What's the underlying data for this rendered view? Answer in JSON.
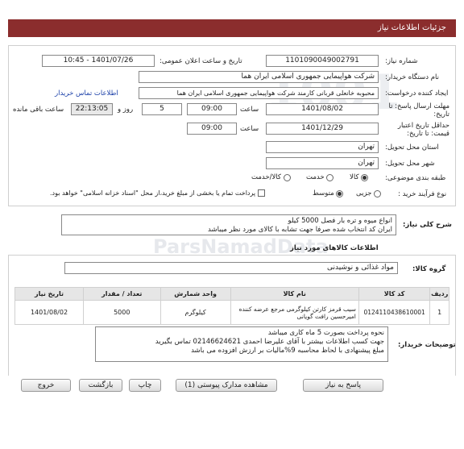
{
  "page_title": "جزئیات اطلاعات نیاز",
  "fields": {
    "need_number_label": "شماره نیاز:",
    "need_number": "1101090049002791",
    "announce_label": "تاریخ و ساعت اعلان عمومی:",
    "announce_value": "1401/07/26 - 10:45",
    "buyer_label": "نام دستگاه خریدار:",
    "buyer_value": "شرکت هواپیمایی جمهوری اسلامی ایران هما",
    "creator_label": "ایجاد کننده درخواست:",
    "creator_value": "محبوبه خانعلی قربانی کارمند شرکت هواپیمایی جمهوری اسلامی ایران هما",
    "contact_link": "اطلاعات تماس خریدار",
    "deadline_label": "مهلت ارسال پاسخ: تا تاریخ:",
    "deadline_date": "1401/08/02",
    "time_label": "ساعت",
    "deadline_time": "09:00",
    "days_value": "5",
    "days_label": "روز و",
    "remaining_time": "22:13:05",
    "remaining_label": "ساعت باقی مانده",
    "validity_label": "حداقل تاریخ اعتبار قیمت: تا تاریخ:",
    "validity_date": "1401/12/29",
    "validity_time": "09:00",
    "province_label": "استان محل تحویل:",
    "province_value": "تهران",
    "city_label": "شهر محل تحویل:",
    "city_value": "تهران",
    "category_label": "طبقه بندی موضوعی:",
    "category_options": [
      "کالا",
      "خدمت",
      "کالا/خدمت"
    ],
    "process_label": "نوع فرآیند خرید :",
    "process_options": [
      "جزیی",
      "متوسط"
    ],
    "payment_note": "پرداخت تمام یا بخشی از مبلغ خرید،از محل \"اسناد خزانه اسلامی\" خواهد بود."
  },
  "summary": {
    "label": "شرح کلی نیاز:",
    "lines": [
      "انواع میوه و تره بار فصل  5000 کیلو",
      "ایران کد انتخاب شده صرفا جهت تشابه با کالای مورد نظر میباشد"
    ]
  },
  "goods": {
    "section_title": "اطلاعات کالاهای مورد نیاز",
    "group_label": "گروه کالا:",
    "group_value": "مواد غذائی و نوشیدنی",
    "columns": [
      "ردیف",
      "کد کالا",
      "نام کالا",
      "واحد شمارش",
      "تعداد / مقدار",
      "تاریخ نیاز"
    ],
    "rows": [
      {
        "row": "1",
        "code": "0124110438610001",
        "name": "سیب قرمز کارتن کیلوگرمی مرجع عرضه کننده امیرحسین رافت گویانی",
        "unit": "کیلوگرم",
        "qty": "5000",
        "date": "1401/08/02"
      }
    ]
  },
  "buyer_notes": {
    "label": "توضیحات خریدار:",
    "lines": [
      "نحوه پرداخت بصورت 5 ماه کاری میباشد",
      "جهت کسب اطلاعات بیشتر با آقای علیرضا احمدی  02146624621 تماس بگیرید",
      "مبلغ پیشنهادی با لحاظ محاسبه 9%مالیات بر ارزش افزوده می باشد"
    ]
  },
  "buttons": {
    "reply": "پاسخ به نیاز",
    "attachments": "مشاهده مدارک پیوستی (1)",
    "print": "چاپ",
    "back": "بازگشت",
    "exit": "خروج"
  },
  "colors": {
    "header": "#8b2d2d",
    "link": "#1a3fa8"
  }
}
